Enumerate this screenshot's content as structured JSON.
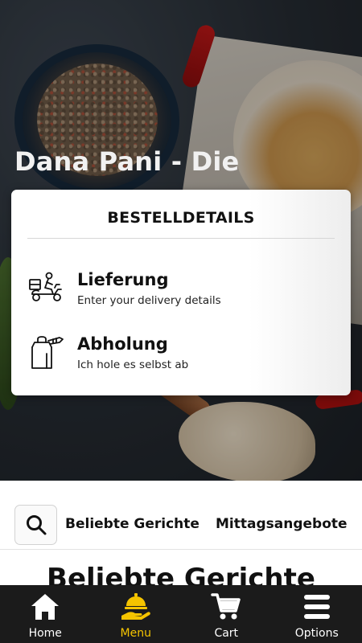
{
  "restaurant": {
    "title": "Dana Pani - Die"
  },
  "order_modal": {
    "title": "BESTELLDETAILS",
    "options": [
      {
        "label": "Lieferung",
        "sub": "Enter your delivery details",
        "icon": "delivery-scooter-icon"
      },
      {
        "label": "Abholung",
        "sub": "Ich hole es selbst ab",
        "icon": "takeaway-bag-icon"
      }
    ]
  },
  "categories": {
    "search_icon": "search-icon",
    "items": [
      "Beliebte Gerichte",
      "Mittagsangebote"
    ]
  },
  "section": {
    "heading": "Beliebte Gerichte"
  },
  "bottom_nav": {
    "items": [
      {
        "label": "Home",
        "icon": "home-icon"
      },
      {
        "label": "Menu",
        "icon": "menu-serving-icon",
        "active": true
      },
      {
        "label": "Cart",
        "icon": "cart-icon"
      },
      {
        "label": "Options",
        "icon": "hamburger-icon"
      }
    ],
    "active_color": "#f5c400"
  }
}
